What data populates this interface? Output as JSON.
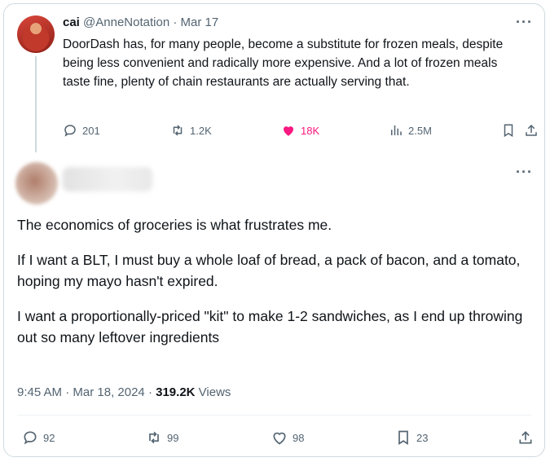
{
  "tweet1": {
    "name": "cai",
    "handle": "@AnneNotation",
    "separator": "·",
    "date": "Mar 17",
    "text": "DoorDash has, for many people, become a substitute for frozen meals, despite being less convenient and radically more expensive. And a lot of frozen meals taste fine, plenty of chain restaurants are actually serving that.",
    "replies": "201",
    "retweets": "1.2K",
    "likes": "18K",
    "views": "2.5M"
  },
  "tweet2": {
    "paragraphs": [
      "The economics of groceries is what frustrates me.",
      "If I want a BLT, I must buy a whole loaf of bread, a pack of bacon, and a tomato, hoping my mayo hasn't expired.",
      "I want a proportionally-priced \"kit\" to make 1-2 sandwiches, as I end up throwing out so many leftover ingredients"
    ],
    "time": "9:45 AM",
    "separator": "·",
    "date": "Mar 18, 2024",
    "views_count": "319.2K",
    "views_label": "Views",
    "replies": "92",
    "retweets": "99",
    "likes": "98",
    "bookmarks": "23"
  },
  "more_icon_glyph": "···",
  "colors": {
    "text": "#0f1419",
    "muted": "#536471",
    "like": "#f91880",
    "border": "#cfd9de"
  }
}
